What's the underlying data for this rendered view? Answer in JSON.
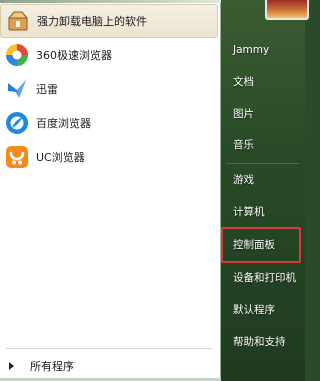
{
  "start_menu": {
    "programs": [
      {
        "label": "强力卸载电脑上的软件",
        "icon": "uninstall-box-icon"
      },
      {
        "label": "360极速浏览器",
        "icon": "360-browser-icon"
      },
      {
        "label": "迅雷",
        "icon": "thunder-icon"
      },
      {
        "label": "百度浏览器",
        "icon": "baidu-browser-icon"
      },
      {
        "label": "UC浏览器",
        "icon": "uc-browser-icon"
      }
    ],
    "all_programs_label": "所有程序",
    "right_items": [
      {
        "label": "Jammy"
      },
      {
        "label": "文档"
      },
      {
        "label": "图片"
      },
      {
        "label": "音乐"
      },
      {
        "label": "游戏"
      },
      {
        "label": "计算机"
      },
      {
        "label": "控制面板"
      },
      {
        "label": "设备和打印机"
      },
      {
        "label": "默认程序"
      },
      {
        "label": "帮助和支持"
      }
    ],
    "highlight_color": "#d83a3a"
  }
}
